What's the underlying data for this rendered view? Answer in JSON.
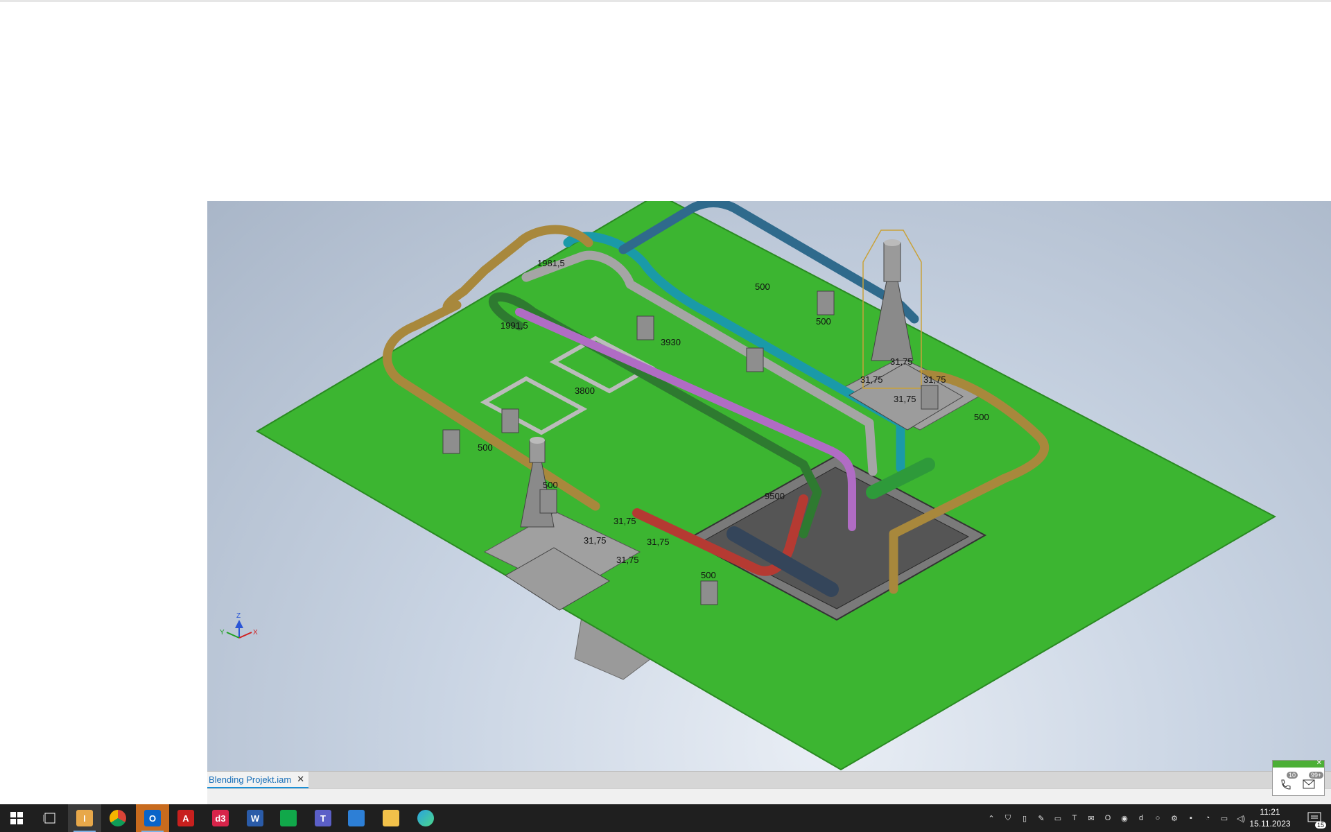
{
  "document": {
    "tab_label": "Blending Projekt.iam"
  },
  "viewport": {
    "ground_color": "#3cb531",
    "background_color": "#c9d4e3",
    "dimensions": [
      "1981,5",
      "1991,5",
      "3930",
      "3800",
      "9500",
      "500",
      "500",
      "500",
      "500",
      "500",
      "500",
      "31,75",
      "31,75",
      "31,75",
      "31,75",
      "31,75",
      "31,75",
      "31,75",
      "31,75"
    ],
    "axis_labels": {
      "x": "X",
      "y": "Y",
      "z": "Z"
    }
  },
  "pipes": {
    "colors": {
      "brown": "#a8883c",
      "teal": "#1a9aa8",
      "navy": "#2f6a8c",
      "gray": "#a5a5a5",
      "purple": "#b06cc4",
      "darkgreen": "#2e7a30",
      "red": "#b53a32"
    }
  },
  "taskbar": {
    "apps": [
      {
        "name": "windows-start",
        "label": ""
      },
      {
        "name": "task-view",
        "label": ""
      },
      {
        "name": "inventor",
        "label": "I"
      },
      {
        "name": "chrome",
        "label": ""
      },
      {
        "name": "outlook",
        "label": "O"
      },
      {
        "name": "autocad",
        "label": "A"
      },
      {
        "name": "d3",
        "label": "d3"
      },
      {
        "name": "word",
        "label": "W"
      },
      {
        "name": "sheets",
        "label": ""
      },
      {
        "name": "teams",
        "label": "T"
      },
      {
        "name": "remote",
        "label": ""
      },
      {
        "name": "explorer",
        "label": ""
      },
      {
        "name": "edge",
        "label": ""
      }
    ],
    "time": "11:21",
    "date": "15.11.2023",
    "notification_count": "15"
  },
  "popup": {
    "calls_badge": "10",
    "mail_badge": "99+"
  }
}
